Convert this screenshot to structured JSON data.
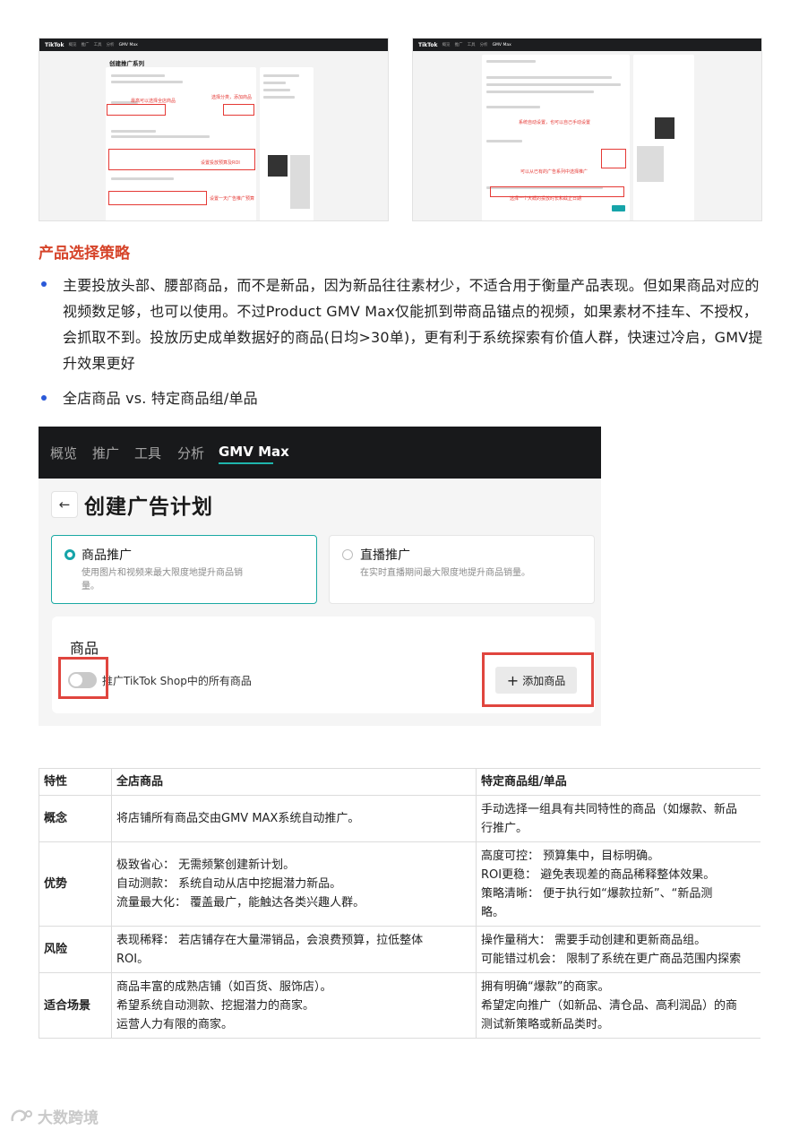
{
  "screenshot_left": {
    "brand": "TikTok",
    "nav": [
      "概览",
      "推广",
      "工具",
      "分析",
      "GMV Max"
    ],
    "title": "创建推广系列",
    "annotations": [
      "选择分类，添加商品",
      "最高可以选择全店商品",
      "设置投放预算及ROI",
      "设置一天广告推广预算"
    ]
  },
  "screenshot_right": {
    "brand": "TikTok",
    "nav": [
      "概览",
      "推广",
      "工具",
      "分析",
      "GMV Max"
    ],
    "annotations": [
      "系统自动设置，也可以自己手动设置",
      "可以从已有的广告系列中选择推广",
      "选择一个大概的投放时长和截止日期"
    ]
  },
  "section_heading": "产品选择策略",
  "bullets": [
    "主要投放头部、腰部商品，而不是新品，因为新品往往素材少，不适合用于衡量产品表现。但如果商品对应的视频数足够，也可以使用。不过Product GMV Max仅能抓到带商品锚点的视频，如果素材不挂车、不授权，会抓取不到。投放历史成单数据好的商品(日均>30单)，更有利于系统探索有价值人群，快速过冷启，GMV提升效果更好",
    "全店商品 vs. 特定商品组/单品"
  ],
  "ui": {
    "tabs": [
      "概览",
      "推广",
      "工具",
      "分析",
      "GMV Max"
    ],
    "back_icon": "←",
    "page_title": "创建广告计划",
    "option1": {
      "title": "商品推广",
      "desc": "使用图片和视频来最大限度地提升商品销量。",
      "selected": true
    },
    "option2": {
      "title": "直播推广",
      "desc": "在实时直播期间最大限度地提升商品销量。",
      "selected": false
    },
    "products_label": "商品",
    "toggle_label": "推广TikTok Shop中的所有商品",
    "add_button": "添加商品",
    "plus_icon": "+"
  },
  "table": {
    "headers": [
      "特性",
      "全店商品",
      "特定商品组/单品"
    ],
    "rows": [
      {
        "label": "概念",
        "all_store": [
          "将店铺所有商品交由GMV MAX系统自动推广。"
        ],
        "specific": [
          "手动选择一组具有共同特性的商品（如爆款、新品",
          "行推广。"
        ]
      },
      {
        "label": "优势",
        "all_store": [
          "极致省心： 无需频繁创建新计划。",
          "自动测款： 系统自动从店中挖掘潜力新品。",
          "流量最大化： 覆盖最广，能触达各类兴趣人群。"
        ],
        "specific": [
          "高度可控： 预算集中，目标明确。",
          "ROI更稳： 避免表现差的商品稀释整体效果。",
          "策略清晰： 便于执行如“爆款拉新”、“新品测",
          "略。"
        ]
      },
      {
        "label": "风险",
        "all_store": [
          "表现稀释： 若店铺存在大量滞销品，会浪费预算，拉低整体",
          "ROI。"
        ],
        "specific": [
          "操作量稍大： 需要手动创建和更新商品组。",
          "可能错过机会： 限制了系统在更广商品范围内探索"
        ]
      },
      {
        "label": "适合场景",
        "all_store": [
          "商品丰富的成熟店铺（如百货、服饰店）。",
          "希望系统自动测款、挖掘潜力的商家。",
          "运营人力有限的商家。"
        ],
        "specific": [
          "拥有明确“爆款”的商家。",
          "希望定向推广（如新品、清仓品、高利润品）的商",
          "测试新策略或新品类时。"
        ]
      }
    ]
  },
  "watermark": "大数跨境",
  "colors": {
    "heading": "#d6442a",
    "bullet": "#2a59d8",
    "accent": "#16a4a9",
    "highlight": "#e0453e"
  }
}
